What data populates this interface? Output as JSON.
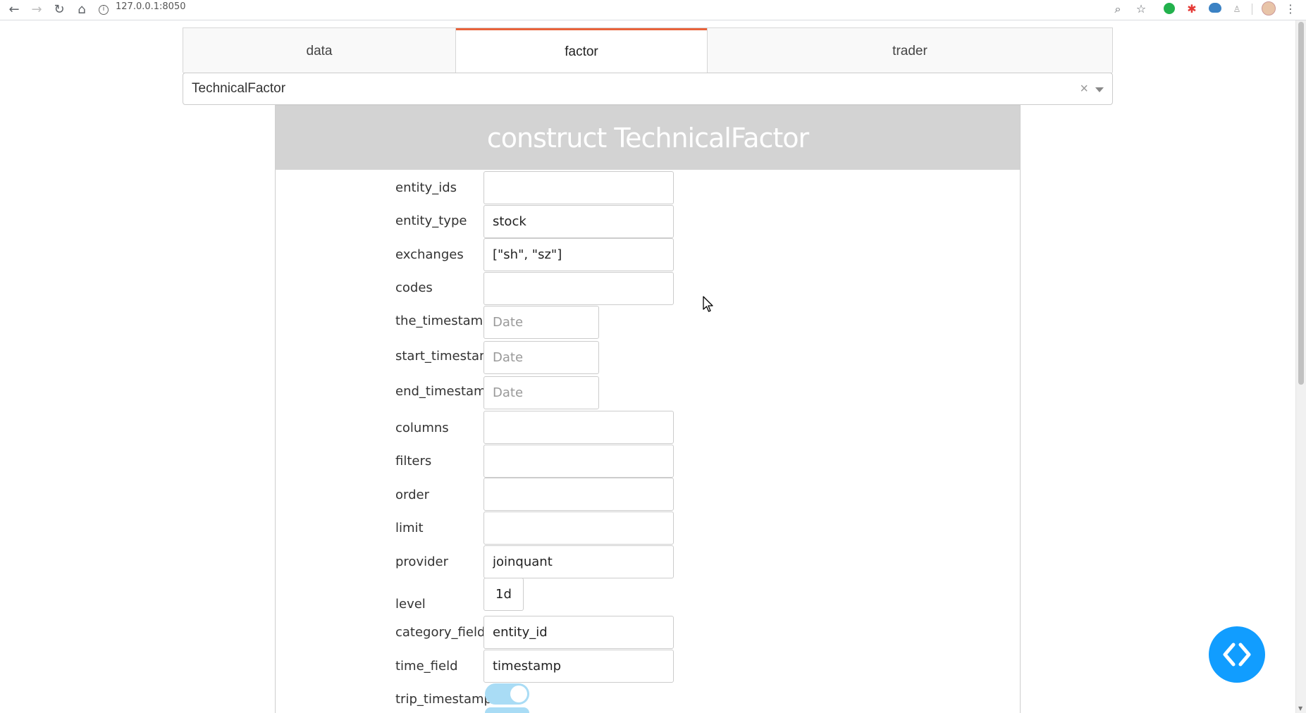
{
  "browser": {
    "url": "127.0.0.1:8050"
  },
  "tabs": [
    {
      "label": "data",
      "active": false
    },
    {
      "label": "factor",
      "active": true
    },
    {
      "label": "trader",
      "active": false
    }
  ],
  "factor_select": {
    "value": "TechnicalFactor",
    "clear_glyph": "×"
  },
  "panel": {
    "title": "construct TechnicalFactor"
  },
  "form": {
    "entity_ids": {
      "label": "entity_ids",
      "value": ""
    },
    "entity_type": {
      "label": "entity_type",
      "value": "stock"
    },
    "exchanges": {
      "label": "exchanges",
      "value": "[\"sh\", \"sz\"]"
    },
    "codes": {
      "label": "codes",
      "value": ""
    },
    "the_timestamp": {
      "label": "the_timestamp",
      "placeholder": "Date"
    },
    "start_timestamp": {
      "label": "start_timestamp",
      "placeholder": "Date"
    },
    "end_timestamp": {
      "label": "end_timestamp",
      "placeholder": "Date"
    },
    "columns": {
      "label": "columns",
      "value": ""
    },
    "filters": {
      "label": "filters",
      "value": ""
    },
    "order": {
      "label": "order",
      "value": ""
    },
    "limit": {
      "label": "limit",
      "value": ""
    },
    "provider": {
      "label": "provider",
      "value": "joinquant"
    },
    "level": {
      "label": "level",
      "value": "1d"
    },
    "category_field": {
      "label": "category_field",
      "value": "entity_id"
    },
    "time_field": {
      "label": "time_field",
      "value": "timestamp"
    },
    "trip_timestamp": {
      "label": "trip_timestamp",
      "checked": true
    }
  },
  "colors": {
    "active_tab_accent": "#e8633b",
    "panel_header_bg": "#d3d3d3",
    "toggle_on": "#a9dcf5",
    "fab_bg": "#119dff"
  }
}
